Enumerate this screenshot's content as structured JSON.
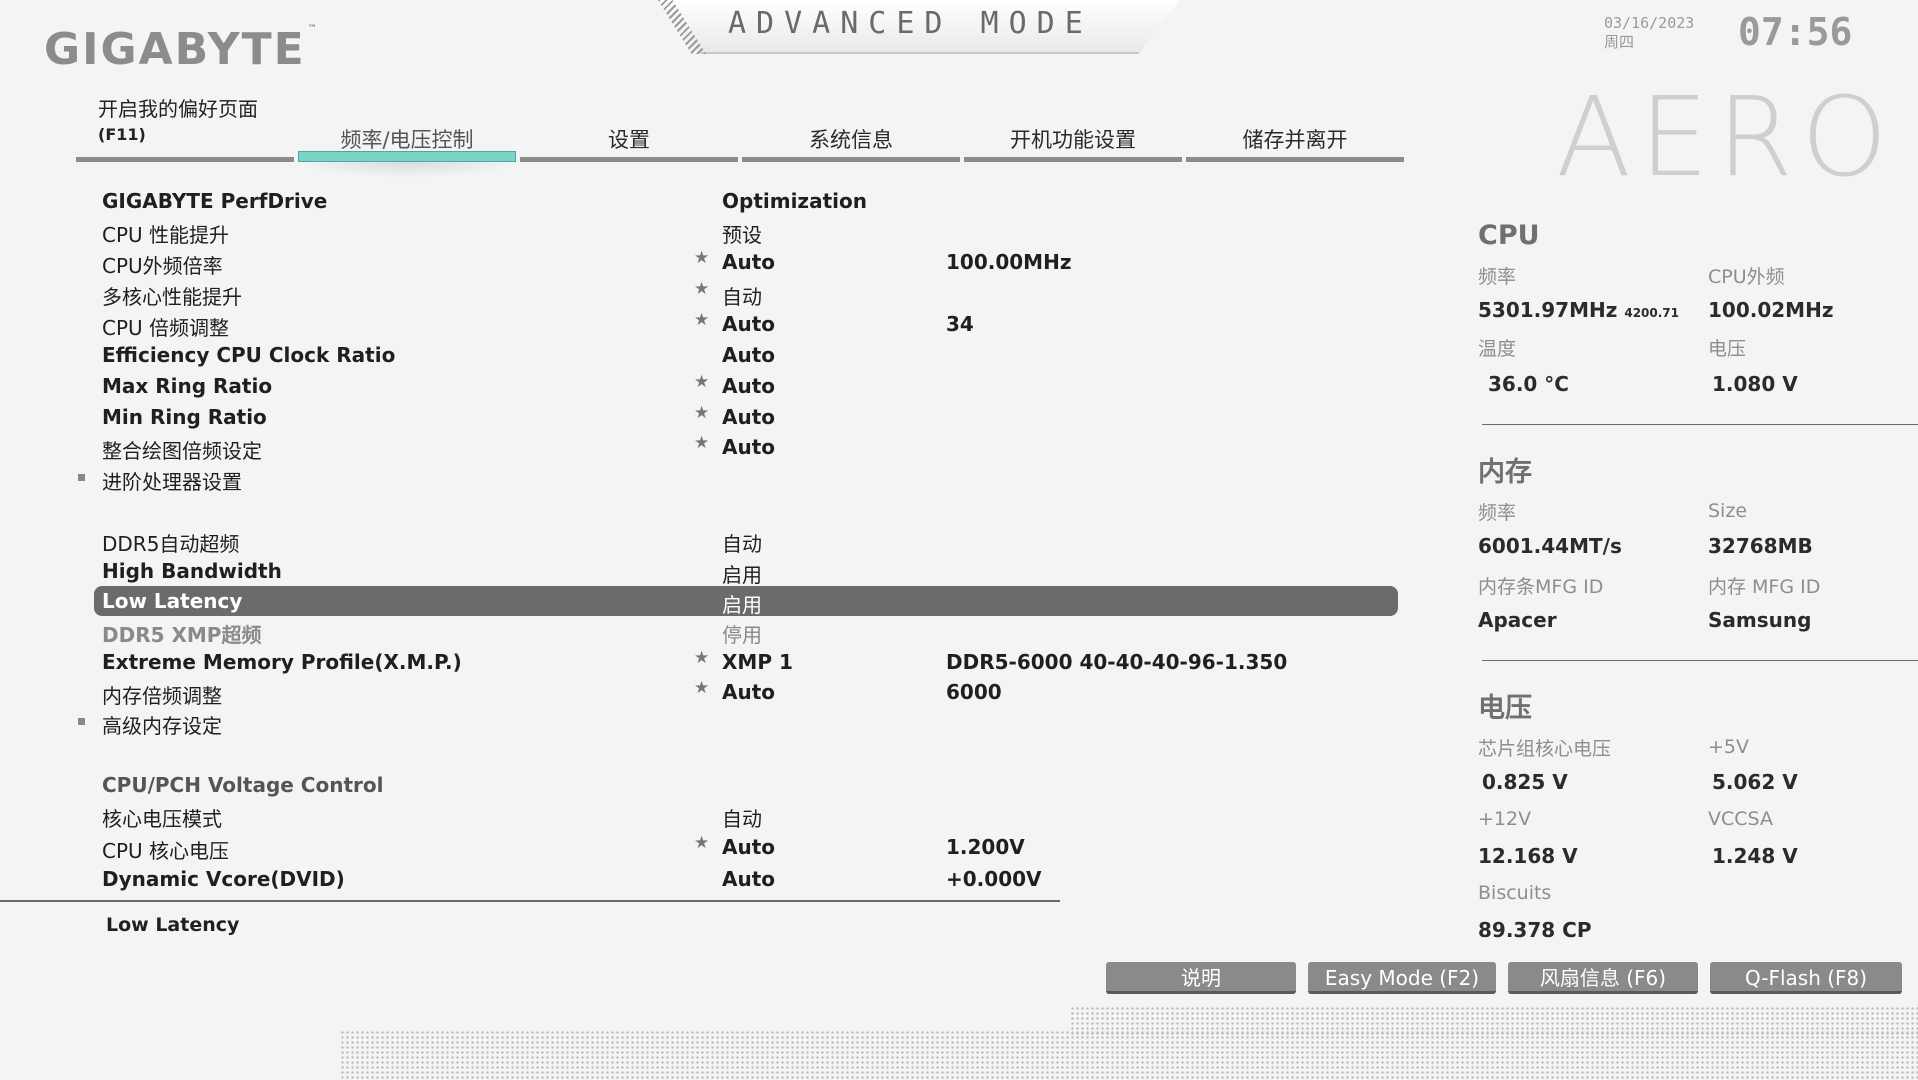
{
  "header": {
    "brand": "GIGABYTE",
    "brand_tm": "™",
    "mode_title": "ADVANCED MODE",
    "date": "03/16/2023",
    "weekday": "周四",
    "time": "07:56",
    "series_logo": "AERO"
  },
  "tabs": {
    "favorites_label": "开启我的偏好页面",
    "favorites_key": "(F11)",
    "items": [
      {
        "label": "频率/电压控制",
        "active": true
      },
      {
        "label": "设置"
      },
      {
        "label": "系统信息"
      },
      {
        "label": "开机功能设置"
      },
      {
        "label": "储存并离开"
      }
    ]
  },
  "settings": [
    {
      "label": "GIGABYTE PerfDrive",
      "value": "Optimization"
    },
    {
      "label": "CPU 性能提升",
      "value": "预设"
    },
    {
      "label": "CPU外频倍率",
      "value": "Auto",
      "value2": "100.00MHz"
    },
    {
      "label": "多核心性能提升",
      "value": "自动"
    },
    {
      "label": "CPU 倍频调整",
      "value": "Auto",
      "value2": "34"
    },
    {
      "label": "Efficiency CPU Clock Ratio",
      "value": "Auto"
    },
    {
      "label": "Max Ring Ratio",
      "value": "Auto"
    },
    {
      "label": "Min Ring Ratio",
      "value": "Auto"
    },
    {
      "label": "整合绘图倍频设定",
      "value": "Auto"
    },
    {
      "label": "进阶处理器设置"
    },
    {
      "label": "DDR5自动超频",
      "value": "自动"
    },
    {
      "label": "High Bandwidth",
      "value": "启用"
    },
    {
      "label": "Low Latency",
      "value": "启用"
    },
    {
      "label": "DDR5 XMP超频",
      "value": "停用"
    },
    {
      "label": "Extreme Memory Profile(X.M.P.)",
      "value": "XMP 1",
      "value2": "DDR5-6000 40-40-40-96-1.350"
    },
    {
      "label": "内存倍频调整",
      "value": "Auto",
      "value2": "6000"
    },
    {
      "label": "高级内存设定"
    },
    {
      "label": "CPU/PCH Voltage Control"
    },
    {
      "label": "核心电压模式",
      "value": "自动"
    },
    {
      "label": "CPU 核心电压",
      "value": "Auto",
      "value2": "1.200V"
    },
    {
      "label": "Dynamic Vcore(DVID)",
      "value": "Auto",
      "value2": "+0.000V"
    }
  ],
  "help_text": "Low Latency",
  "panel": {
    "cpu": {
      "title": "CPU",
      "freq_label": "频率",
      "freq_value": "5301.97MHz",
      "freq_sub": "4200.71",
      "bclk_label": "CPU外频",
      "bclk_value": "100.02MHz",
      "temp_label": "温度",
      "temp_value": "36.0 °C",
      "volt_label": "电压",
      "volt_value": "1.080 V"
    },
    "memory": {
      "title": "内存",
      "freq_label": "频率",
      "freq_value": "6001.44MT/s",
      "size_label": "Size",
      "size_value": "32768MB",
      "mfg_label": "内存条MFG ID",
      "mfg_value": "Apacer",
      "chip_label": "内存 MFG ID",
      "chip_value": "Samsung"
    },
    "voltage": {
      "title": "电压",
      "chipset_label": "芯片组核心电压",
      "chipset_value": "0.825 V",
      "v5_label": "+5V",
      "v5_value": "5.062 V",
      "v12_label": "+12V",
      "v12_value": "12.168 V",
      "vccsa_label": "VCCSA",
      "vccsa_value": "1.248 V",
      "biscuits_label": "Biscuits",
      "biscuits_value": "89.378 CP"
    }
  },
  "buttons": {
    "help": "说明",
    "easy_mode": "Easy Mode (F2)",
    "fan_info": "风扇信息 (F6)",
    "qflash": "Q-Flash (F8)"
  }
}
